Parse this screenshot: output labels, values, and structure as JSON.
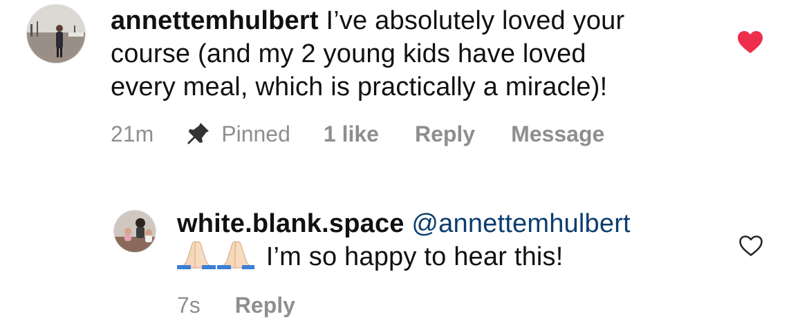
{
  "comments": [
    {
      "username": "annettemhulbert",
      "text_line1": " I’ve absolutely loved your",
      "text_line2": "course (and my 2 young kids have loved",
      "text_line3": "every meal, which is practically a miracle)!",
      "time": "21m",
      "pinned_label": "Pinned",
      "likes_label": "1 like",
      "reply_label": "Reply",
      "message_label": "Message",
      "liked": true,
      "avatar_icon": "avatar-photo-harbor"
    }
  ],
  "reply": {
    "username": "white.blank.space",
    "mention": "@annettemhulbert",
    "emoji_icon": "folded-hands-emoji",
    "text": " I’m so happy to hear this!",
    "time": "7s",
    "reply_label": "Reply",
    "liked": false,
    "avatar_icon": "avatar-photo-family"
  },
  "colors": {
    "heart_liked": "#ed2f4b",
    "meta_gray": "#8e8e8e",
    "mention": "#0b3d6e"
  }
}
